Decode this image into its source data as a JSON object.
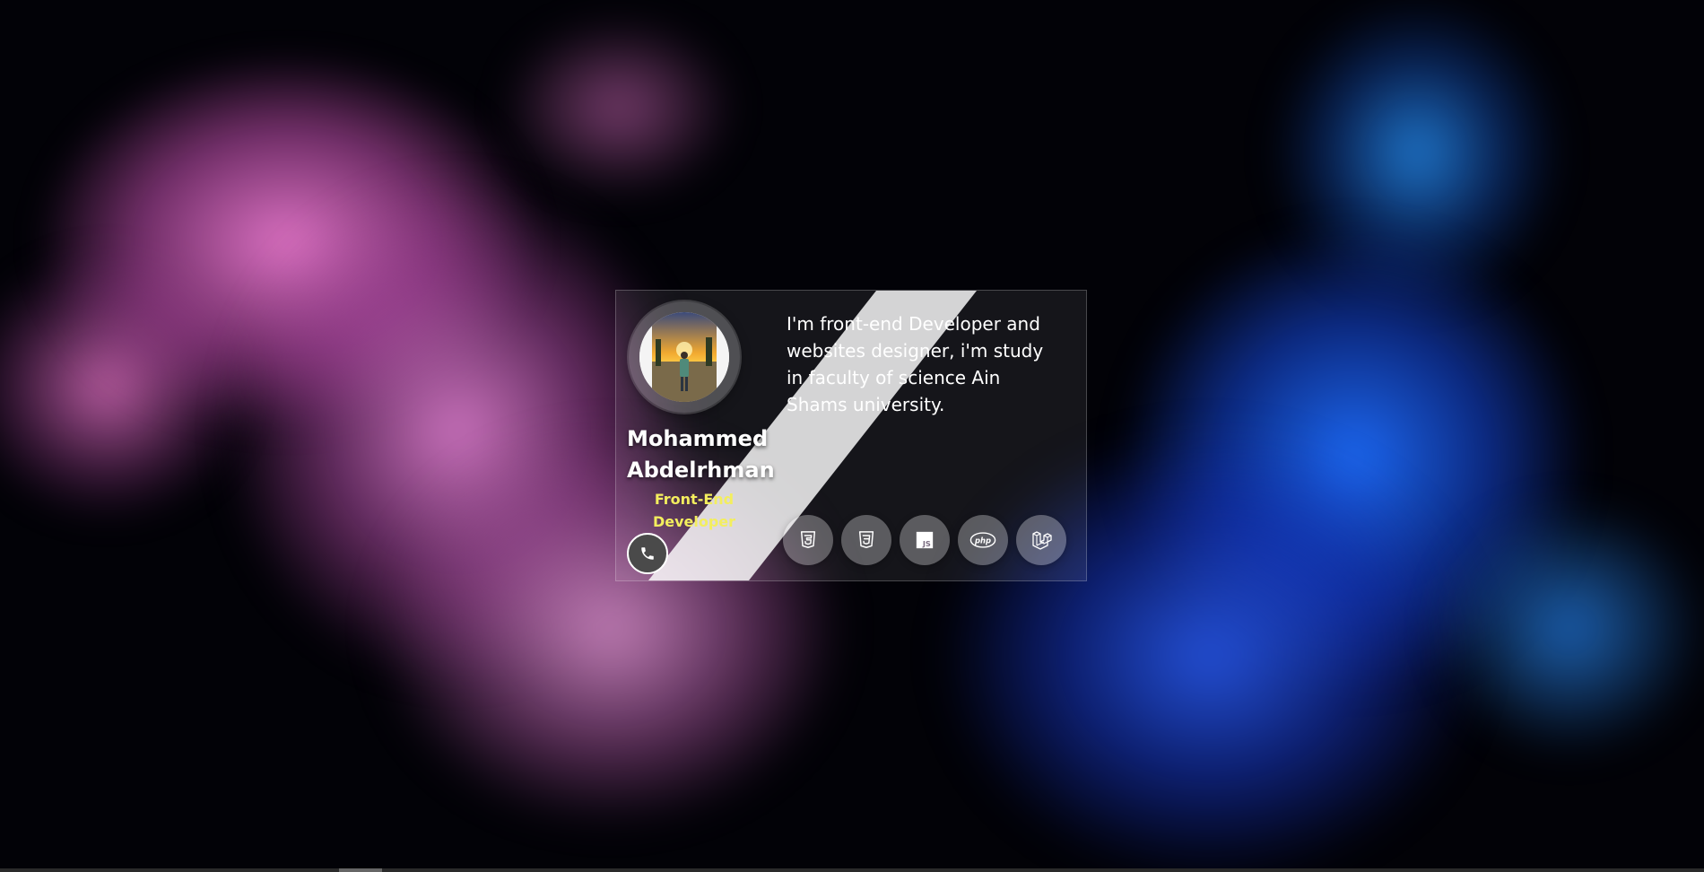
{
  "profile": {
    "name": "Mohammed Abdelrhman",
    "role": "Front-End Developer",
    "bio": "I'm front-end Developer and websites designer, i'm study in faculty of science Ain Shams university."
  },
  "contact": {
    "phone_icon": "phone-icon"
  },
  "skills": [
    {
      "icon": "html5-icon"
    },
    {
      "icon": "css3-icon"
    },
    {
      "icon": "javascript-icon",
      "label": "JS"
    },
    {
      "icon": "php-icon",
      "label": "php"
    },
    {
      "icon": "laravel-icon"
    }
  ],
  "colors": {
    "role_text": "#f3ee5e",
    "name_text": "#ffffff",
    "phone_button_bg": "#4a4a4a",
    "pink_ink": "#e078cd",
    "blue_ink": "#1e6eff"
  }
}
